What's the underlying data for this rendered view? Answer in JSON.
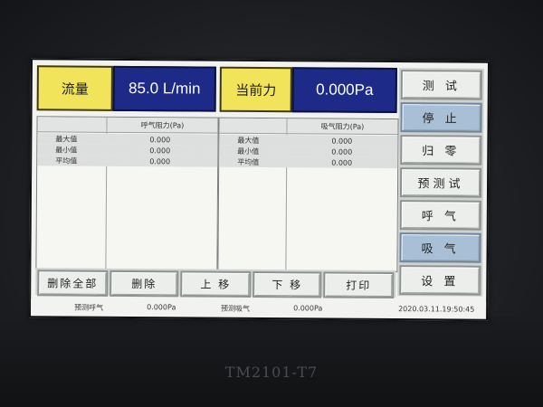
{
  "device": {
    "model": "TM2101-T7"
  },
  "readouts": {
    "flow_label": "流量",
    "flow_value": "85.0 L/min",
    "force_label": "当前力",
    "force_value": "0.000Pa"
  },
  "side_buttons": [
    {
      "label": "测 试",
      "active": false
    },
    {
      "label": "停 止",
      "active": true
    },
    {
      "label": "归 零",
      "active": false
    },
    {
      "label": "预测试",
      "active": false
    },
    {
      "label": "呼 气",
      "active": false
    },
    {
      "label": "吸 气",
      "active": true
    },
    {
      "label": "设 置",
      "active": false
    }
  ],
  "exhale_table": {
    "header": "呼气阻力(Pa)",
    "rows": [
      {
        "label": "最大值",
        "value": "0.000"
      },
      {
        "label": "最小值",
        "value": "0.000"
      },
      {
        "label": "平均值",
        "value": "0.000"
      }
    ]
  },
  "inhale_table": {
    "header": "吸气阻力(Pa)",
    "rows": [
      {
        "label": "最大值",
        "value": "0.000"
      },
      {
        "label": "最小值",
        "value": "0.000"
      },
      {
        "label": "平均值",
        "value": "0.000"
      }
    ]
  },
  "bottom_buttons": {
    "delete_all": "删除全部",
    "delete": "删除",
    "move_up": "上 移",
    "move_down": "下 移",
    "print": "打印"
  },
  "status": {
    "pretest_exhale_label": "预测呼气",
    "pretest_exhale_value": "0.000Pa",
    "pretest_inhale_label": "预测吸气",
    "pretest_inhale_value": "0.000Pa",
    "datetime": "2020.03.11.19:50:45"
  },
  "colors": {
    "label_yellow": "#f1e45a",
    "value_blue": "#1d2a88",
    "active_button": "#a8bfd6"
  }
}
